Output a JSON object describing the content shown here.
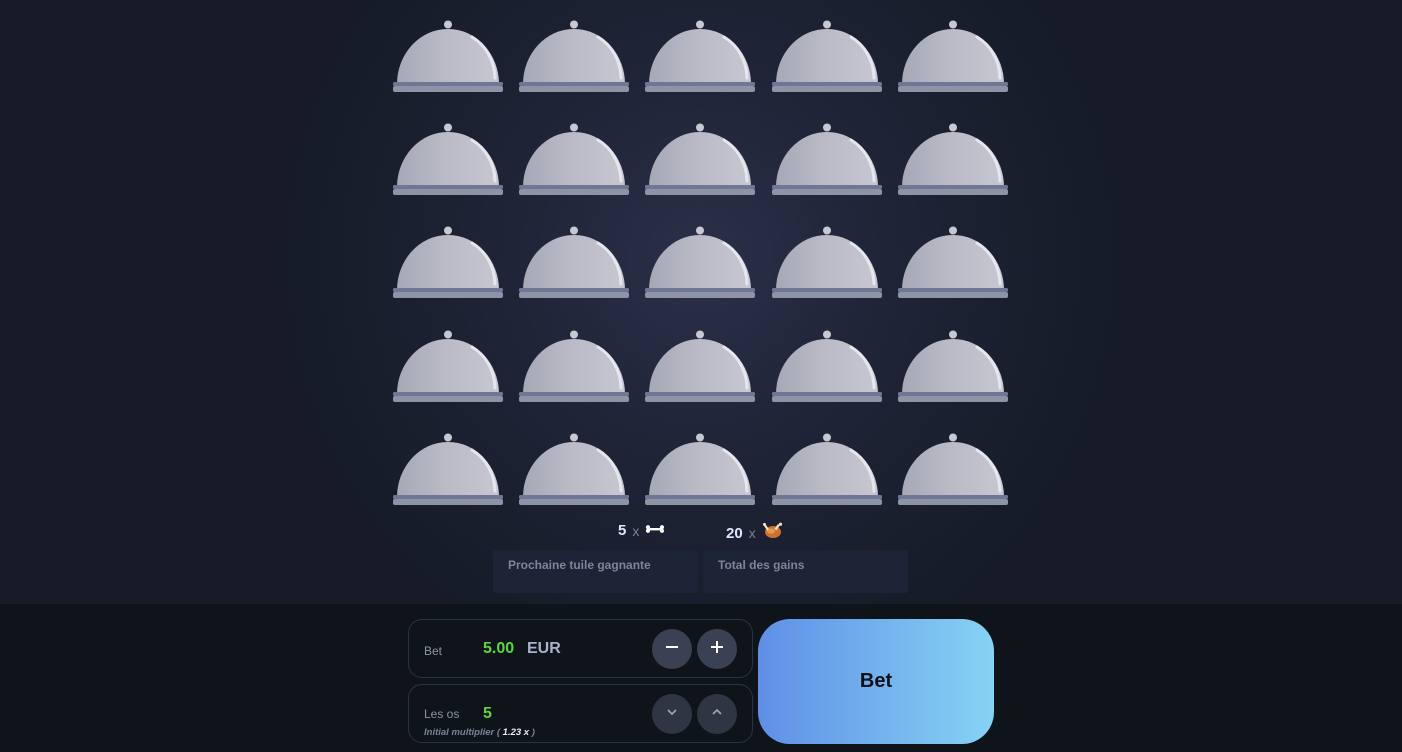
{
  "board": {
    "rows": 5,
    "cols": 5,
    "tile_icon": "cloche-icon"
  },
  "counts": {
    "bones": {
      "value": "5",
      "sep": "x",
      "icon": "bone-icon"
    },
    "chickens": {
      "value": "20",
      "sep": "x",
      "icon": "roast-chicken-icon"
    }
  },
  "info": {
    "next_tile_label": "Prochaine tuile gagnante",
    "total_label": "Total des gains"
  },
  "bet": {
    "label": "Bet",
    "amount": "5.00",
    "currency": "EUR",
    "minus_icon": "minus-icon",
    "plus_icon": "plus-icon"
  },
  "bones_setting": {
    "label": "Les os",
    "value": "5",
    "note_prefix": "Initial multiplier (",
    "multiplier": "1.23 x",
    "note_suffix": ")"
  },
  "bet_button": {
    "label": "Bet"
  },
  "colors": {
    "accent_green": "#5ad83a",
    "button_gradient_start": "#5f8fe6",
    "button_gradient_end": "#86d3f4",
    "background": "#161b27"
  }
}
